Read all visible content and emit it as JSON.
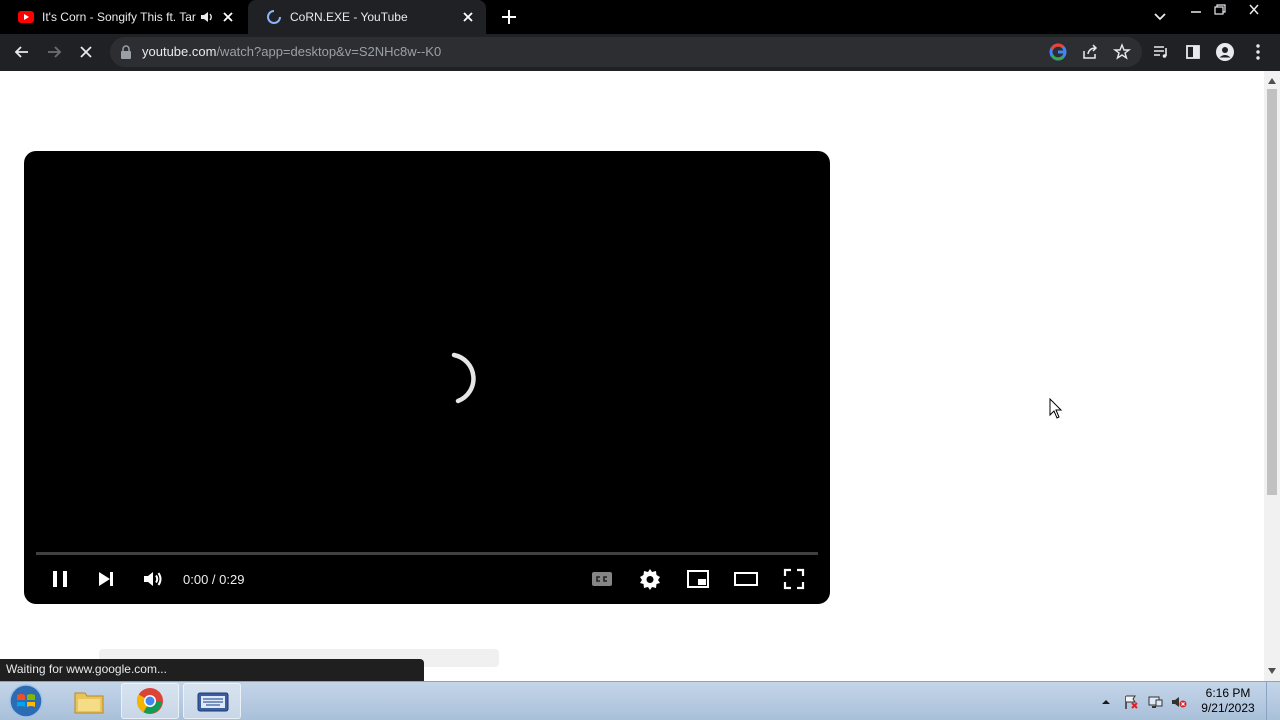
{
  "browser": {
    "tabs": [
      {
        "title": "It's Corn - Songify This ft. Tari",
        "favicon": "youtube-icon",
        "audio": "speaker-icon"
      },
      {
        "title": "CoRN.EXE - YouTube",
        "favicon": "loading-spinner-icon",
        "active": true
      }
    ],
    "url": {
      "host": "youtube.com",
      "path": "/watch?app=desktop&v=S2NHc8w--K0"
    }
  },
  "player": {
    "state": "loading",
    "time_display": "0:00 / 0:29",
    "progress_fraction": 0.0
  },
  "status_bar": {
    "text": "Waiting for www.google.com..."
  },
  "taskbar": {
    "clock_time": "6:16 PM",
    "clock_date": "9/21/2023"
  },
  "colors": {
    "tab_strip": "#000000",
    "toolbar": "#202124",
    "youtube_red": "#ff0000"
  }
}
